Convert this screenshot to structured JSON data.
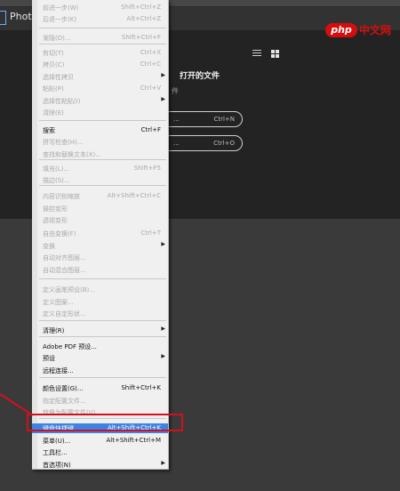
{
  "app": {
    "title": "Phot"
  },
  "start_panel": {
    "heading": "打开的文件",
    "subtext": "件",
    "pill1": {
      "left": "...",
      "shortcut": "Ctrl+N"
    },
    "pill2": {
      "left": "...",
      "shortcut": "Ctrl+O"
    }
  },
  "watermark": {
    "badge": "php",
    "text": "中文网"
  },
  "menu": {
    "items": [
      {
        "label": "前进一步(W)",
        "shortcut": "Shift+Ctrl+Z",
        "disabled": true
      },
      {
        "label": "后退一步(K)",
        "shortcut": "Alt+Ctrl+Z",
        "disabled": true
      },
      {
        "label": "渐隐(D)...",
        "shortcut": "Shift+Ctrl+F",
        "disabled": true
      },
      {
        "label": "剪切(T)",
        "shortcut": "Ctrl+X",
        "disabled": true
      },
      {
        "label": "拷贝(C)",
        "shortcut": "Ctrl+C",
        "disabled": true
      },
      {
        "label": "选择性拷贝",
        "shortcut": "",
        "disabled": true,
        "submenu": true
      },
      {
        "label": "粘贴(P)",
        "shortcut": "Ctrl+V",
        "disabled": true
      },
      {
        "label": "选择性粘贴(I)",
        "shortcut": "",
        "disabled": true,
        "submenu": true
      },
      {
        "label": "清除(E)",
        "shortcut": "",
        "disabled": true
      },
      {
        "label": "搜索",
        "shortcut": "Ctrl+F",
        "disabled": false
      },
      {
        "label": "拼写检查(H)...",
        "shortcut": "",
        "disabled": true
      },
      {
        "label": "查找和替换文本(X)...",
        "shortcut": "",
        "disabled": true
      },
      {
        "label": "填充(L)...",
        "shortcut": "Shift+F5",
        "disabled": true
      },
      {
        "label": "描边(S)...",
        "shortcut": "",
        "disabled": true
      },
      {
        "label": "内容识别缩放",
        "shortcut": "Alt+Shift+Ctrl+C",
        "disabled": true
      },
      {
        "label": "操控变形",
        "shortcut": "",
        "disabled": true
      },
      {
        "label": "透视变形",
        "shortcut": "",
        "disabled": true
      },
      {
        "label": "自由变换(F)",
        "shortcut": "Ctrl+T",
        "disabled": true
      },
      {
        "label": "变换",
        "shortcut": "",
        "disabled": true,
        "submenu": true
      },
      {
        "label": "自动对齐图层...",
        "shortcut": "",
        "disabled": true
      },
      {
        "label": "自动混合图层...",
        "shortcut": "",
        "disabled": true
      },
      {
        "label": "定义画笔预设(B)...",
        "shortcut": "",
        "disabled": true
      },
      {
        "label": "定义图案...",
        "shortcut": "",
        "disabled": true
      },
      {
        "label": "定义自定形状...",
        "shortcut": "",
        "disabled": true
      },
      {
        "label": "清理(R)",
        "shortcut": "",
        "disabled": false,
        "submenu": true
      },
      {
        "label": "Adobe PDF 预设...",
        "shortcut": "",
        "disabled": false
      },
      {
        "label": "预设",
        "shortcut": "",
        "disabled": false,
        "submenu": true
      },
      {
        "label": "远程连接...",
        "shortcut": "",
        "disabled": false
      },
      {
        "label": "颜色设置(G)...",
        "shortcut": "Shift+Ctrl+K",
        "disabled": false
      },
      {
        "label": "指定配置文件...",
        "shortcut": "",
        "disabled": true
      },
      {
        "label": "转换为配置文件(V)...",
        "shortcut": "",
        "disabled": true
      },
      {
        "label": "键盘快捷键...",
        "shortcut": "Alt+Shift+Ctrl+K",
        "disabled": false,
        "highlighted": true
      },
      {
        "label": "菜单(U)...",
        "shortcut": "Alt+Shift+Ctrl+M",
        "disabled": false
      },
      {
        "label": "工具栏...",
        "shortcut": "",
        "disabled": false
      },
      {
        "label": "首选项(N)",
        "shortcut": "",
        "disabled": false,
        "submenu": true
      }
    ]
  }
}
